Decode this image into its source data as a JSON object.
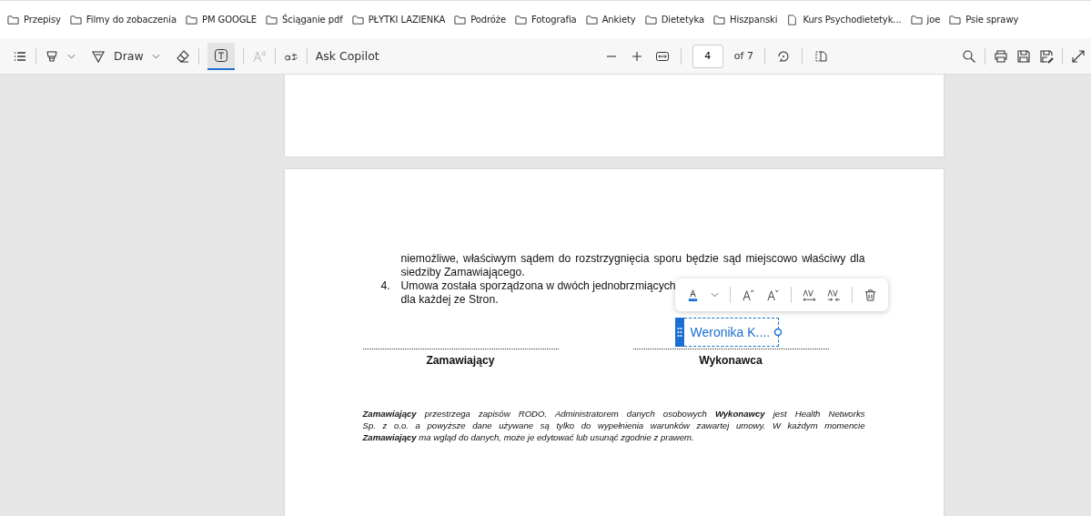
{
  "bookmarks": [
    {
      "label": "Przepisy",
      "kind": "folder"
    },
    {
      "label": "Filmy do zobaczenia",
      "kind": "folder"
    },
    {
      "label": "PM GOOGLE",
      "kind": "folder"
    },
    {
      "label": "Ściąganie pdf",
      "kind": "folder"
    },
    {
      "label": "PŁYTKI LAZIENKA",
      "kind": "folder"
    },
    {
      "label": "Podróże",
      "kind": "folder"
    },
    {
      "label": "Fotografia",
      "kind": "folder"
    },
    {
      "label": "Ankiety",
      "kind": "folder"
    },
    {
      "label": "Dietetyka",
      "kind": "folder"
    },
    {
      "label": "Hiszpanski",
      "kind": "folder"
    },
    {
      "label": "Kurs Psychodietetyk...",
      "kind": "page"
    },
    {
      "label": "joe",
      "kind": "folder"
    },
    {
      "label": "Psie sprawy",
      "kind": "folder"
    }
  ],
  "toolbar": {
    "draw_label": "Draw",
    "text_tool": {
      "selected": true
    },
    "read_aloud": {
      "disabled": true
    },
    "copilot_label": "Ask Copilot",
    "page_number": "4",
    "page_total": "of 7"
  },
  "document": {
    "paragraph_lines": [
      "niemożliwe, właściwym sądem do rozstrzygnięcia sporu będzie sąd miejscowo właściwy dla",
      "siedziby Zamawiającego."
    ],
    "item_number": "4.",
    "item_lines": [
      "Umowa została sporządzona w dwóch jednobrzmiących",
      "dla każdej ze Stron."
    ],
    "signatures": [
      "Zamawiający",
      "Wykonawca"
    ],
    "rodo_lines": [
      "**Zamawiający** przestrzega zapisów RODO. Administratorem danych osobowych **Wykonawcy** jest Health Networks",
      "Sp. z o.o. a powyższe dane używane są tylko do wypełnienia warunków zawartej umowy. W każdym momencie",
      "**Zamawiający** ma wgląd do danych, może je edytować lub usunąć zgodnie z prawem."
    ],
    "annotation": {
      "text": "Weronika K...."
    }
  }
}
